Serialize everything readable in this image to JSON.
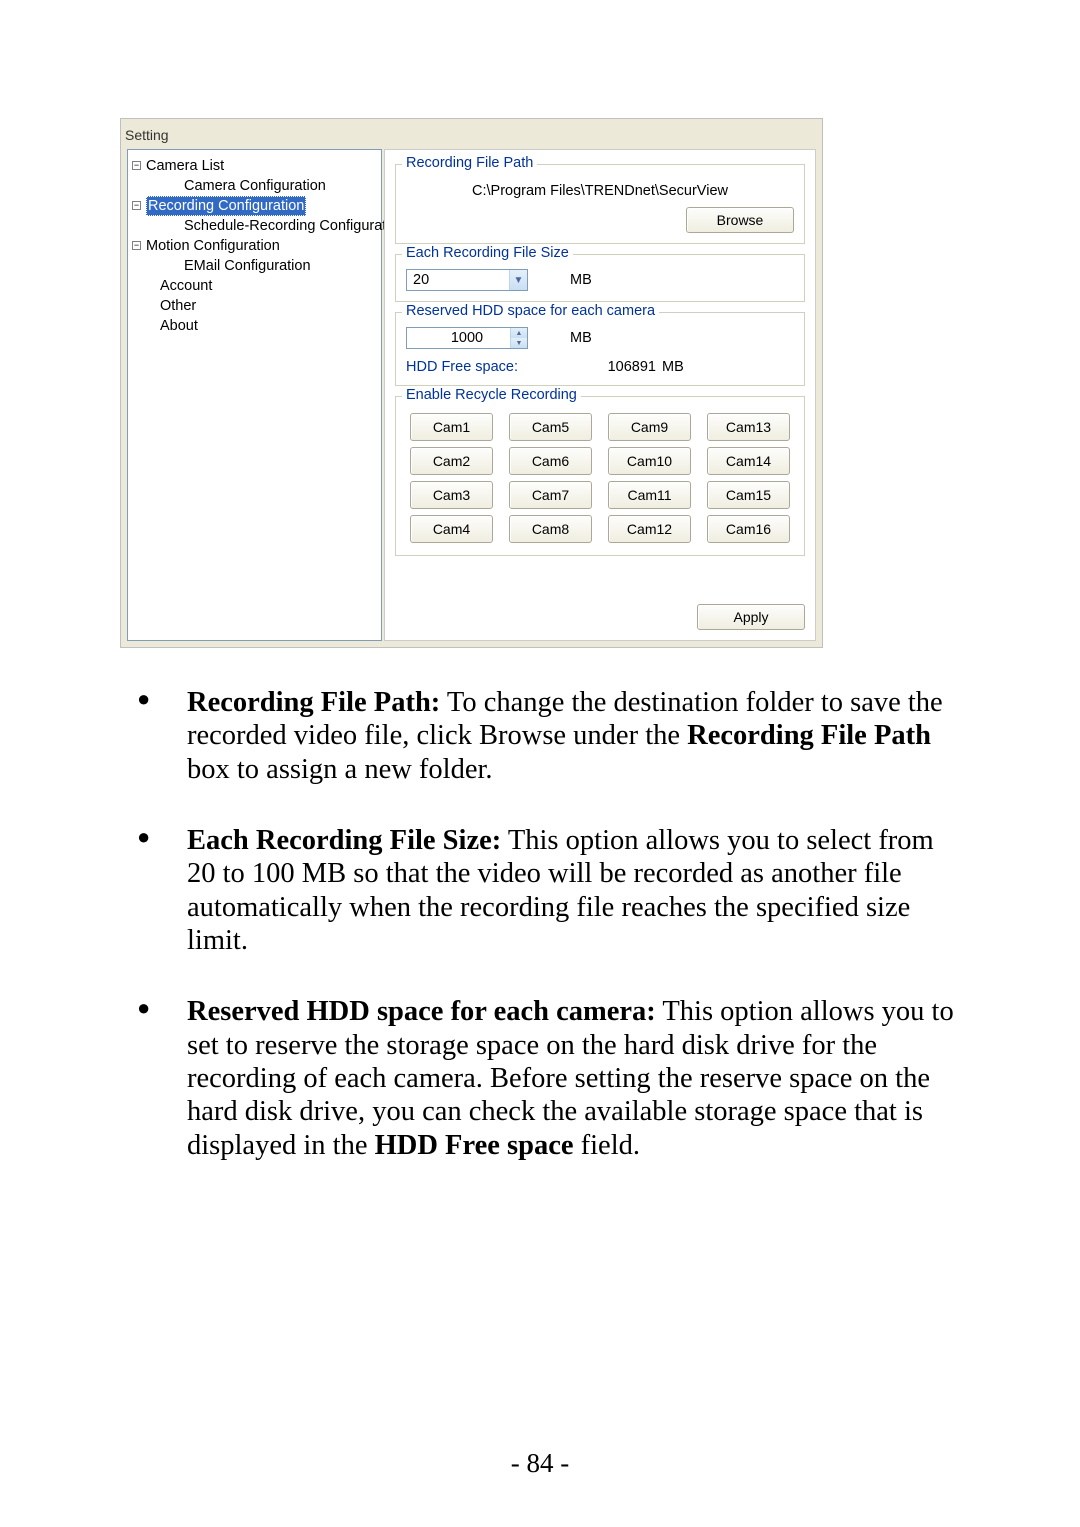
{
  "screenshot": {
    "title": "Setting",
    "tree": {
      "camera_list": "Camera List",
      "camera_configuration": "Camera Configuration",
      "recording_configuration": "Recording Configuration",
      "schedule_recording_configuration": "Schedule-Recording Configuration",
      "motion_configuration": "Motion Configuration",
      "email_configuration": "EMail Configuration",
      "account": "Account",
      "other": "Other",
      "about": "About"
    },
    "recording_file_path": {
      "legend": "Recording File Path",
      "value": "C:\\Program Files\\TRENDnet\\SecurView",
      "browse": "Browse"
    },
    "file_size": {
      "legend": "Each Recording File Size",
      "value": "20",
      "unit": "MB"
    },
    "reserved": {
      "legend": "Reserved HDD space for each camera",
      "value": "1000",
      "unit": "MB",
      "free_label": "HDD Free space:",
      "free_value": "106891",
      "free_unit": "MB"
    },
    "recycle": {
      "legend": "Enable Recycle Recording",
      "cams": [
        "Cam1",
        "Cam2",
        "Cam3",
        "Cam4",
        "Cam5",
        "Cam6",
        "Cam7",
        "Cam8",
        "Cam9",
        "Cam10",
        "Cam11",
        "Cam12",
        "Cam13",
        "Cam14",
        "Cam15",
        "Cam16"
      ]
    },
    "apply": "Apply"
  },
  "doc": {
    "items": [
      {
        "label": "Recording File Path:",
        "pre": "",
        "mid": "  To change the destination folder to save the recorded video file, click Browse under the ",
        "bold2": "Recording File Path",
        "post": " box to assign a new folder."
      },
      {
        "label": "Each Recording File Size:",
        "pre": "",
        "mid": "  This option allows you to select from 20 to 100 MB so that the video will be recorded as another file automatically when the recording file reaches the specified size limit.",
        "bold2": "",
        "post": ""
      },
      {
        "label": "Reserved HDD space for each camera:",
        "pre": "",
        "mid": "  This option allows you to set to reserve the storage space on the hard disk drive for the recording of each camera.  Before setting the reserve space on the hard disk drive, you can check the available storage space that is displayed in the ",
        "bold2": "HDD Free space",
        "post": " field."
      }
    ]
  },
  "page_number": "- 84 -"
}
